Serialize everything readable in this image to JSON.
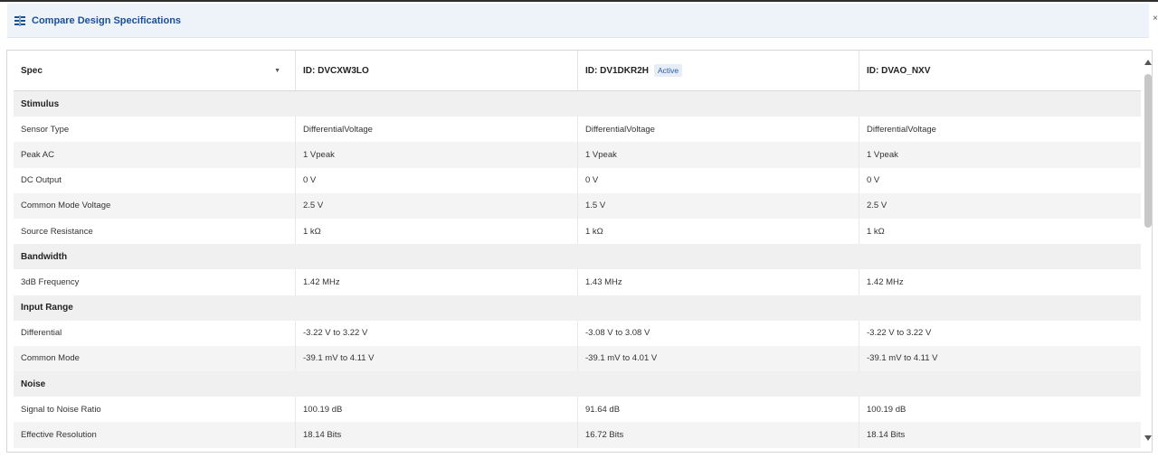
{
  "dialog": {
    "title": "Compare Design Specifications",
    "close_glyph": "×",
    "icon": "compare-icon"
  },
  "table": {
    "spec_header": "Spec",
    "columns": [
      {
        "id_label": "ID: DVCXW3LO",
        "badge": ""
      },
      {
        "id_label": "ID: DV1DKR2H",
        "badge": "Active"
      },
      {
        "id_label": "ID: DVAO_NXV",
        "badge": ""
      }
    ],
    "sections": [
      {
        "title": "Stimulus",
        "rows": [
          {
            "label": "Sensor Type",
            "values": [
              "DifferentialVoltage",
              "DifferentialVoltage",
              "DifferentialVoltage"
            ]
          },
          {
            "label": "Peak AC",
            "values": [
              "1 Vpeak",
              "1 Vpeak",
              "1 Vpeak"
            ]
          },
          {
            "label": "DC Output",
            "values": [
              "0 V",
              "0 V",
              "0 V"
            ]
          },
          {
            "label": "Common Mode Voltage",
            "values": [
              "2.5 V",
              "1.5 V",
              "2.5 V"
            ]
          },
          {
            "label": "Source Resistance",
            "values": [
              "1 kΩ",
              "1 kΩ",
              "1 kΩ"
            ]
          }
        ]
      },
      {
        "title": "Bandwidth",
        "rows": [
          {
            "label": "3dB Frequency",
            "values": [
              "1.42 MHz",
              "1.43 MHz",
              "1.42 MHz"
            ]
          }
        ]
      },
      {
        "title": "Input Range",
        "rows": [
          {
            "label": "Differential",
            "values": [
              "-3.22 V to 3.22 V",
              "-3.08 V to 3.08 V",
              "-3.22 V to 3.22 V"
            ]
          },
          {
            "label": "Common Mode",
            "values": [
              "-39.1 mV to 4.11 V",
              "-39.1 mV to 4.01 V",
              "-39.1 mV to 4.11 V"
            ]
          }
        ]
      },
      {
        "title": "Noise",
        "rows": [
          {
            "label": "Signal to Noise Ratio",
            "values": [
              "100.19 dB",
              "91.64 dB",
              "100.19 dB"
            ]
          },
          {
            "label": "Effective Resolution",
            "values": [
              "18.14 Bits",
              "16.72 Bits",
              "18.14 Bits"
            ]
          }
        ]
      }
    ]
  },
  "colors": {
    "title": "#1a4f95",
    "header_bg": "#eef3f9",
    "section_bg": "#f0f0f0",
    "alt_row_bg": "#f4f4f4",
    "badge_bg": "#e6edf7",
    "badge_text": "#2a5ea8"
  }
}
